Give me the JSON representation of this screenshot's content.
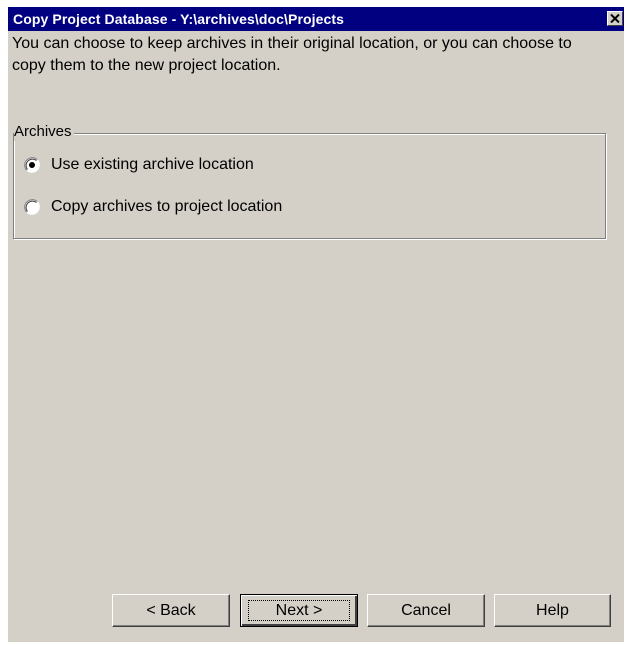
{
  "window": {
    "title": "Copy Project Database - Y:\\archives\\doc\\Projects",
    "close_icon": "close-icon"
  },
  "intro": {
    "text": "You can choose to keep archives in their original location, or you can choose to copy them to the new project location."
  },
  "archives_group": {
    "label": "Archives",
    "options": [
      {
        "label": "Use existing archive location",
        "selected": true
      },
      {
        "label": "Copy archives to project location",
        "selected": false
      }
    ]
  },
  "buttons": {
    "back": "< Back",
    "next": "Next >",
    "cancel": "Cancel",
    "help": "Help"
  },
  "colors": {
    "titlebar": "#000080",
    "dialog_face": "#d4d0c8"
  }
}
